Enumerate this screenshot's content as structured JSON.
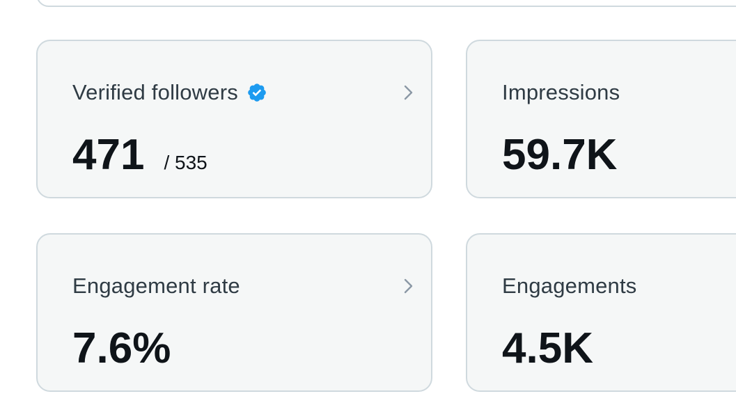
{
  "cards": [
    {
      "title": "Verified followers",
      "value": "471",
      "total": "/ 535",
      "has_badge": true,
      "has_chevron": true
    },
    {
      "title": "Impressions",
      "value": "59.7K"
    },
    {
      "title": "Engagement rate",
      "value": "7.6%",
      "has_chevron": true
    },
    {
      "title": "Engagements",
      "value": "4.5K"
    }
  ],
  "colors": {
    "card_background": "#f5f7f7",
    "card_border": "#cfd9de",
    "title_text": "#2f3b44",
    "value_text": "#0f1419",
    "chevron": "#8b98a5",
    "verified_badge": "#1d9bf0"
  },
  "icons": {
    "verified": "verified-badge-icon",
    "chevron": "chevron-right-icon"
  }
}
